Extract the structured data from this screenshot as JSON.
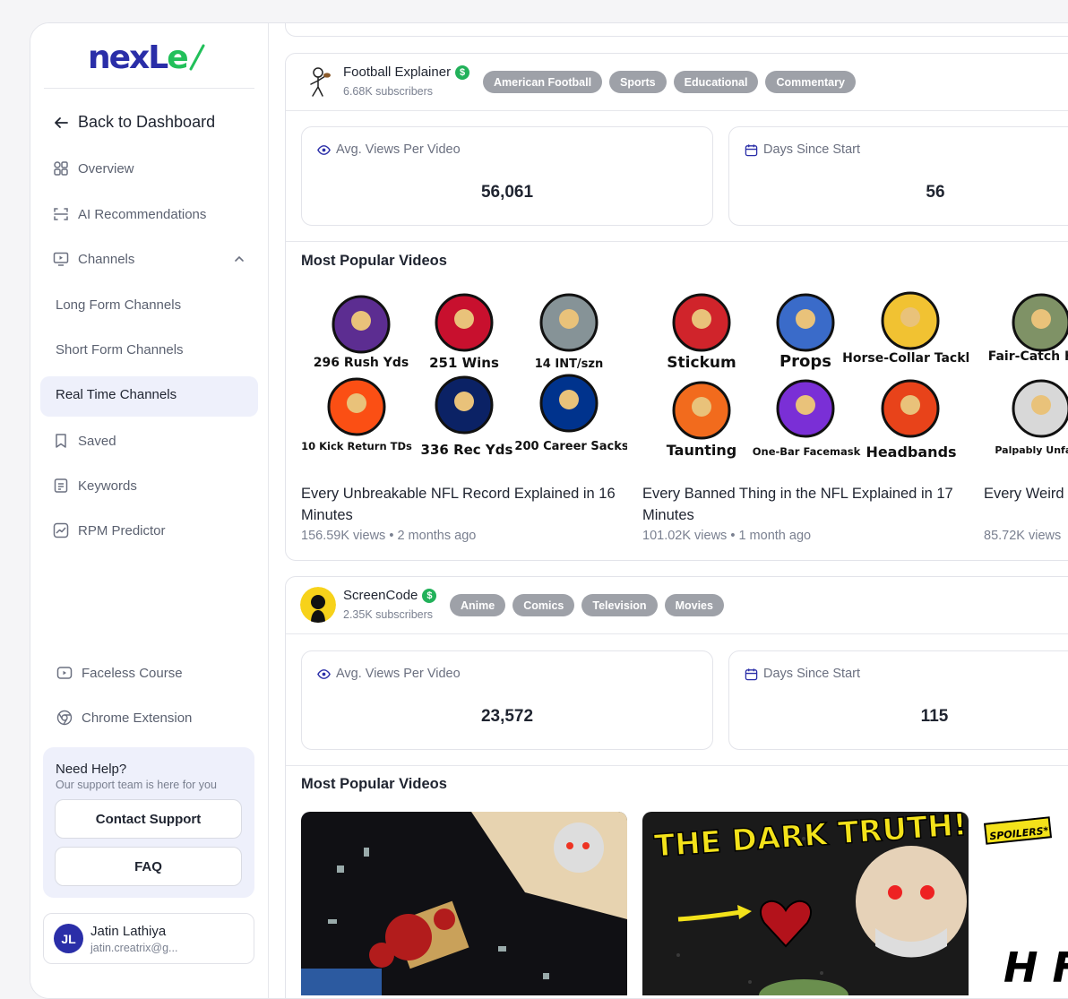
{
  "brand": {
    "logo_text_a": "nexL",
    "logo_text_b": "e"
  },
  "sidebar": {
    "back": "Back to Dashboard",
    "items": [
      {
        "label": "Overview"
      },
      {
        "label": "AI Recommendations"
      },
      {
        "label": "Channels"
      }
    ],
    "channels_sub": [
      {
        "label": "Long Form Channels"
      },
      {
        "label": "Short Form Channels"
      },
      {
        "label": "Real Time Channels"
      }
    ],
    "items2": [
      {
        "label": "Saved"
      },
      {
        "label": "Keywords"
      },
      {
        "label": "RPM Predictor"
      }
    ],
    "bottom": [
      {
        "label": "Faceless Course"
      },
      {
        "label": "Chrome Extension"
      }
    ],
    "help": {
      "title": "Need Help?",
      "subtitle": "Our support team is here for you",
      "contact": "Contact Support",
      "faq": "FAQ"
    },
    "user": {
      "initials": "JL",
      "name": "Jatin Lathiya",
      "email": "jatin.creatrix@g..."
    }
  },
  "channels": [
    {
      "name": "Football Explainer",
      "subscribers": "6.68K subscribers",
      "tags": [
        "American Football",
        "Sports",
        "Educational",
        "Commentary"
      ],
      "avg_label": "Avg. Views Per Video",
      "avg_value": "56,061",
      "days_label": "Days Since Start",
      "days_value": "56",
      "popular_title": "Most Popular Videos",
      "videos": [
        {
          "title": "Every Unbreakable NFL Record Explained in 16 Minutes",
          "views": "156.59K views",
          "age": "2 months ago",
          "thumb_labels": [
            "296 Rush Yds",
            "251 Wins",
            "14 INT/szn",
            "10 Kick Return TDs",
            "336 Rec Yds",
            "200 Career Sacks"
          ]
        },
        {
          "title": "Every Banned Thing in the NFL Explained in 17 Minutes",
          "views": "101.02K views",
          "age": "1 month ago",
          "thumb_labels": [
            "Stickum",
            "Props",
            "Horse-Collar Tackle",
            "Taunting",
            "One-Bar Facemask",
            "Headbands"
          ]
        },
        {
          "title": "Every Weird Rule That Existed Explained",
          "views": "85.72K views",
          "age": "",
          "thumb_labels": [
            "Fair-Catch Kick",
            "Palpably Unfair Act"
          ]
        }
      ]
    },
    {
      "name": "ScreenCode",
      "subscribers": "2.35K subscribers",
      "tags": [
        "Anime",
        "Comics",
        "Television",
        "Movies"
      ],
      "avg_label": "Avg. Views Per Video",
      "avg_value": "23,572",
      "days_label": "Days Since Start",
      "days_value": "115",
      "popular_title": "Most Popular Videos",
      "thumbs": [
        {
          "text": ""
        },
        {
          "text": "THE DARK TRUTH!"
        },
        {
          "badge": "SPOILERS*",
          "text": "H FIN PLA"
        }
      ]
    }
  ],
  "colors": {
    "brand": "#2a2ea8",
    "accent_green": "#22c05a",
    "tag_gray": "#9ea1a8",
    "active_bg": "#eef0fb"
  }
}
